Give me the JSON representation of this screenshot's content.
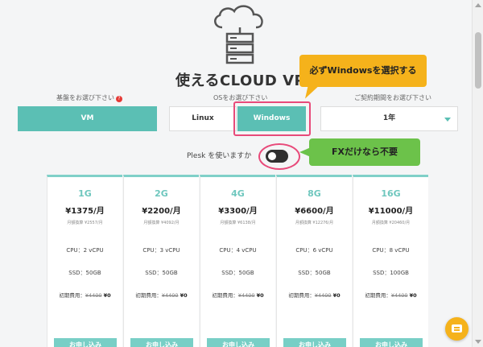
{
  "page": {
    "title": "使えるCLOUD VPS"
  },
  "selectors": {
    "base_label": "基盤をお選び下さい",
    "base_required": "?",
    "base_option": "VM",
    "os_label": "OSをお選び下さい",
    "os_options": [
      "Linux",
      "Windows"
    ],
    "os_selected": "Windows",
    "contract_label": "ご契約期間をお選び下さい",
    "contract_value": "1年"
  },
  "plesk": {
    "label": "Plesk を使いますか",
    "enabled": false
  },
  "callouts": {
    "windows": "必ずWindowsを選択する",
    "fx": "FXだけなら不要"
  },
  "plans": [
    {
      "ram": "1G",
      "price": "¥1375/月",
      "monthly": "月額換算 ¥2557/月",
      "cpu": "CPU：2 vCPU",
      "ssd": "SSD：50GB",
      "initial_label": "初期費用：",
      "initial_old": "¥4400",
      "initial_new": "¥0",
      "apply": "お申し込み"
    },
    {
      "ram": "2G",
      "price": "¥2200/月",
      "monthly": "月額換算 ¥4092/月",
      "cpu": "CPU：3 vCPU",
      "ssd": "SSD：50GB",
      "initial_label": "初期費用：",
      "initial_old": "¥4400",
      "initial_new": "¥0",
      "apply": "お申し込み"
    },
    {
      "ram": "4G",
      "price": "¥3300/月",
      "monthly": "月額換算 ¥6138/月",
      "cpu": "CPU：4 vCPU",
      "ssd": "SSD：50GB",
      "initial_label": "初期費用：",
      "initial_old": "¥4400",
      "initial_new": "¥0",
      "apply": "お申し込み"
    },
    {
      "ram": "8G",
      "price": "¥6600/月",
      "monthly": "月額換算 ¥12276/月",
      "cpu": "CPU：6 vCPU",
      "ssd": "SSD：50GB",
      "initial_label": "初期費用：",
      "initial_old": "¥4400",
      "initial_new": "¥0",
      "apply": "お申し込み"
    },
    {
      "ram": "16G",
      "price": "¥11000/月",
      "monthly": "月額換算 ¥20460/月",
      "cpu": "CPU：8 vCPU",
      "ssd": "SSD：100GB",
      "initial_label": "初期費用：",
      "initial_old": "¥4400",
      "initial_new": "¥0",
      "apply": "お申し込み"
    }
  ],
  "icons": {
    "hero": "cloud-server-icon",
    "chat": "chat-icon",
    "contract_caret": "chevron-down-icon"
  },
  "colors": {
    "accent": "#5bbfb4",
    "highlight": "#e84a7a",
    "callout_orange": "#f5b21b",
    "callout_green": "#6cc24a",
    "toggle_off": "#2f2f2f"
  }
}
